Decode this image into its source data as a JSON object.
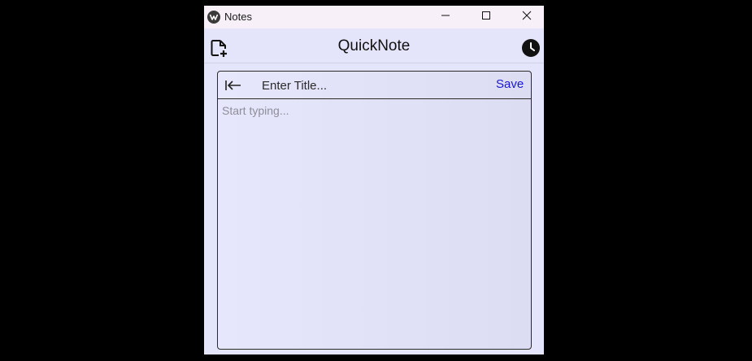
{
  "window": {
    "title": "Notes",
    "controls": {
      "minimize": "minimize-icon",
      "maximize": "maximize-icon",
      "close": "close-icon"
    }
  },
  "header": {
    "title": "QuickNote",
    "new_note_icon": "new-note-icon",
    "history_icon": "clock-icon"
  },
  "editor": {
    "back_icon": "back-to-start-icon",
    "title_placeholder": "Enter Title...",
    "title_value": "",
    "save_label": "Save",
    "body_placeholder": "Start typing...",
    "body_value": ""
  },
  "colors": {
    "accent": "#1a18d6",
    "background": "#e4e4fb",
    "titlebar": "#f7f0f8"
  }
}
